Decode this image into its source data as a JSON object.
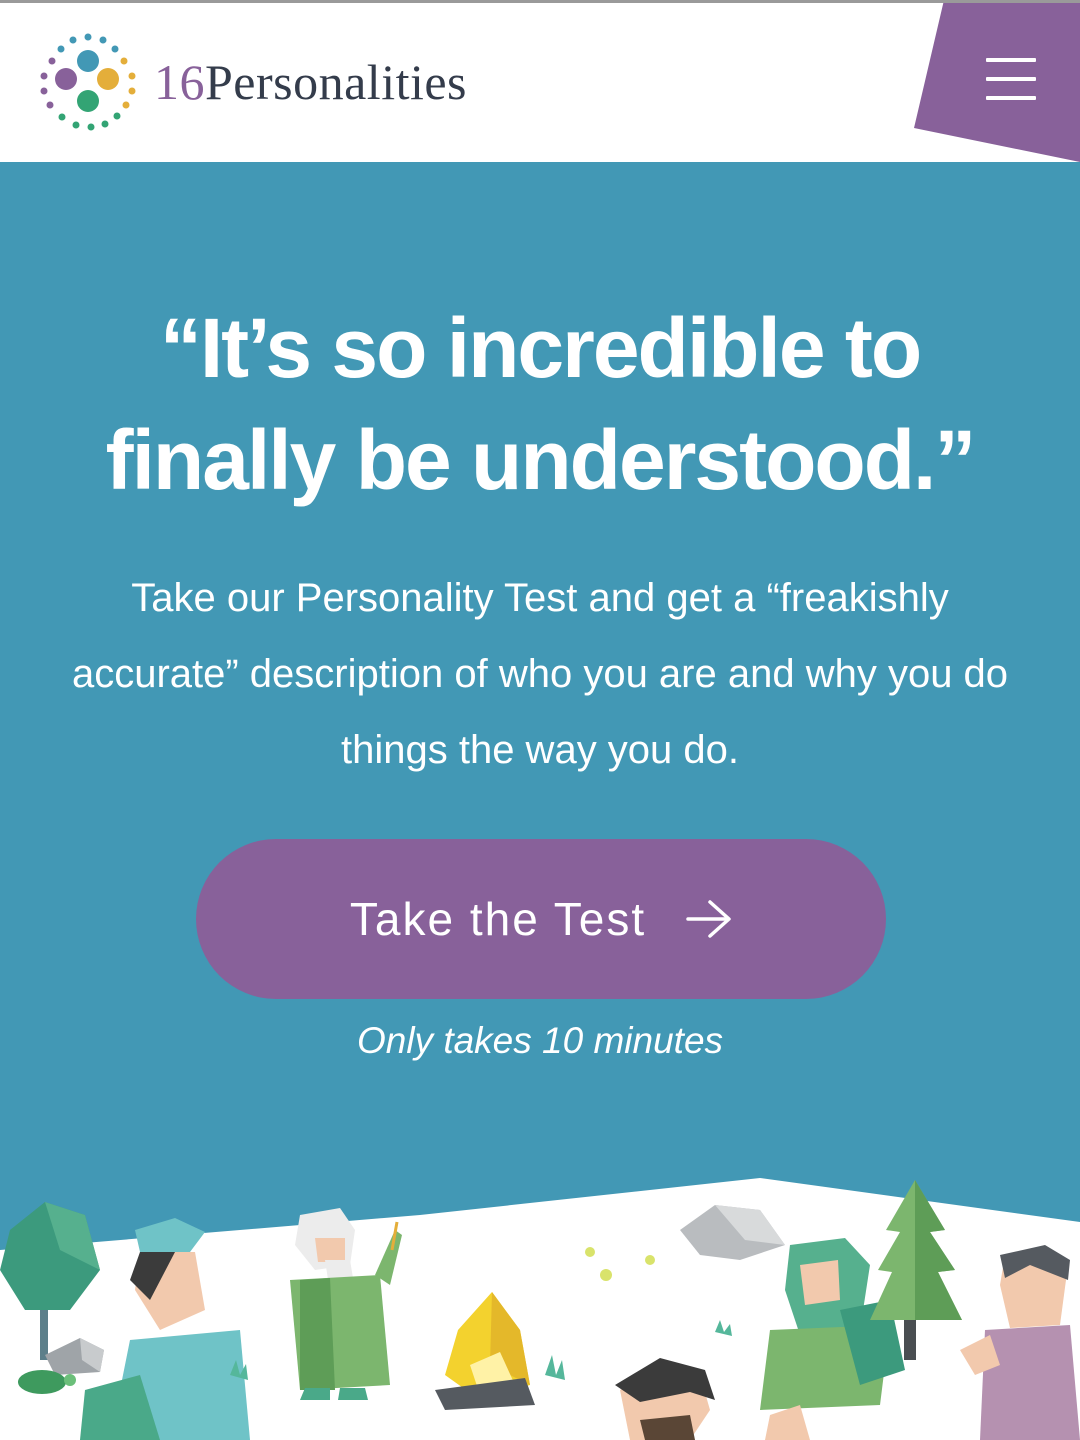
{
  "header": {
    "logo_number": "16",
    "logo_word": "Personalities",
    "menu_icon": "hamburger-menu-icon",
    "accent_color": "#88619a"
  },
  "hero": {
    "headline_line1": "“It’s so incredible to",
    "headline_line2": "finally be understood.”",
    "sub_line1": "Take our Personality Test and get a “freakishly",
    "sub_line2": "accurate” description of who you are and why you do",
    "sub_line3": "things the way you do.",
    "cta_label": "Take the Test",
    "cta_icon": "arrow-right-icon",
    "note": "Only takes 10 minutes",
    "background_color": "#4298b5"
  },
  "illustration": {
    "description_icon": "campfire-scene-illustration"
  }
}
